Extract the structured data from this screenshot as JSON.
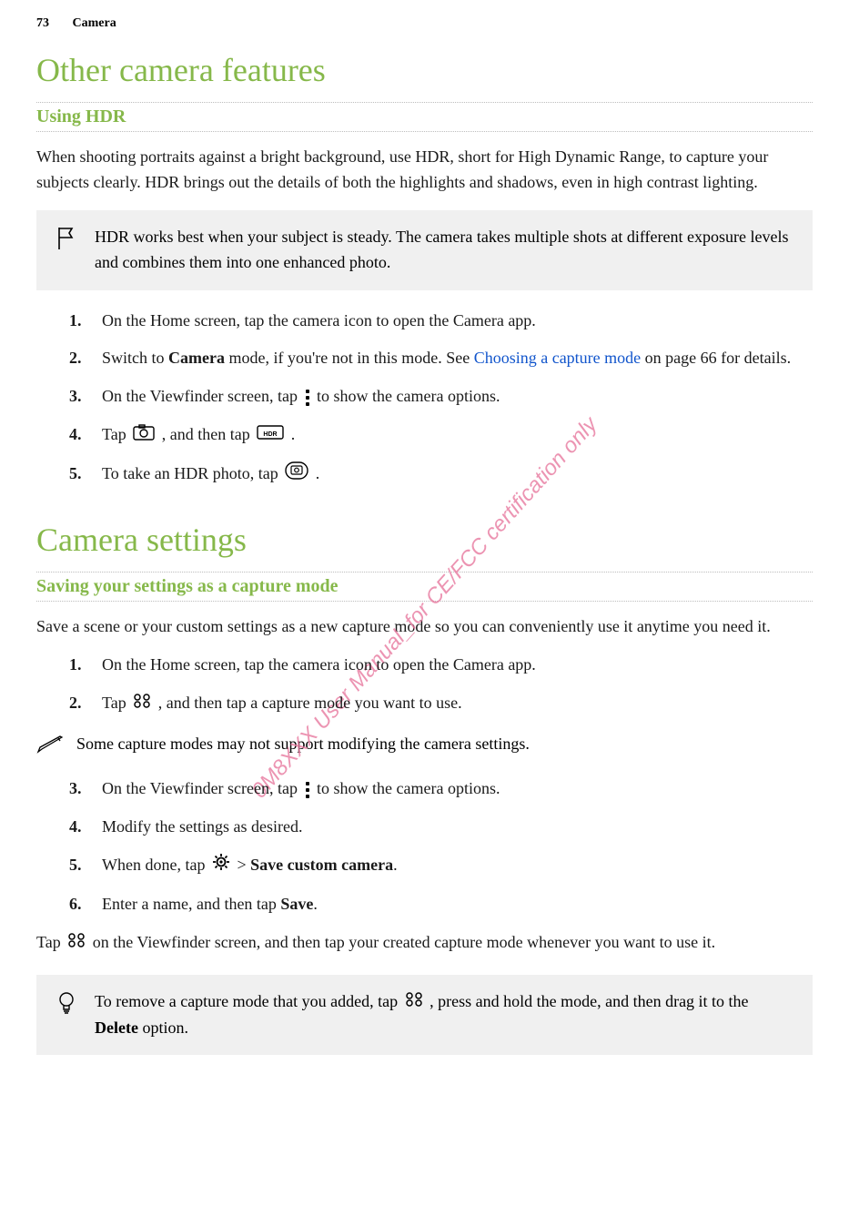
{
  "header": {
    "page_number": "73",
    "section": "Camera"
  },
  "watermark": "0M8XXX User Manual_for CE/FCC certification only",
  "section1": {
    "title": "Other camera features",
    "subtitle": "Using HDR",
    "intro": "When shooting portraits against a bright background, use HDR, short for High Dynamic Range, to capture your subjects clearly. HDR brings out the details of both the highlights and shadows, even in high contrast lighting.",
    "flag_note": "HDR works best when your subject is steady. The camera takes multiple shots at different exposure levels and combines them into one enhanced photo.",
    "steps": [
      {
        "text": "On the Home screen, tap the camera icon to open the Camera app."
      },
      {
        "pre": "Switch to ",
        "bold1": "Camera",
        "mid": " mode, if you're not in this mode. See ",
        "link": "Choosing a capture mode",
        "post": " on page 66 for details."
      },
      {
        "pre": "On the Viewfinder screen, tap ",
        "post": " to show the camera options."
      },
      {
        "pre": "Tap ",
        "mid": " , and then tap ",
        "post": " ."
      },
      {
        "pre": "To take an HDR photo, tap ",
        "post": "."
      }
    ]
  },
  "section2": {
    "title": "Camera settings",
    "subtitle": "Saving your settings as a capture mode",
    "intro": "Save a scene or your custom settings as a new capture mode so you can conveniently use it anytime you need it.",
    "steps_a": [
      {
        "text": "On the Home screen, tap the camera icon to open the Camera app."
      },
      {
        "pre": "Tap ",
        "post": " , and then tap a capture mode you want to use."
      }
    ],
    "note": "Some capture modes may not support modifying the camera settings.",
    "steps_b": [
      {
        "pre": "On the Viewfinder screen, tap ",
        "post": " to show the camera options."
      },
      {
        "text": "Modify the settings as desired."
      },
      {
        "pre": "When done, tap ",
        "mid": " > ",
        "bold": "Save custom camera",
        "post": "."
      },
      {
        "pre": "Enter a name, and then tap ",
        "bold": "Save",
        "post": "."
      }
    ],
    "closing": {
      "pre": "Tap ",
      "post": " on the Viewfinder screen, and then tap your created capture mode whenever you want to use it."
    },
    "tip": {
      "pre": "To remove a capture mode that you added, tap ",
      "mid": " , press and hold the mode, and then drag it to the ",
      "bold": "Delete",
      "post": " option."
    }
  }
}
